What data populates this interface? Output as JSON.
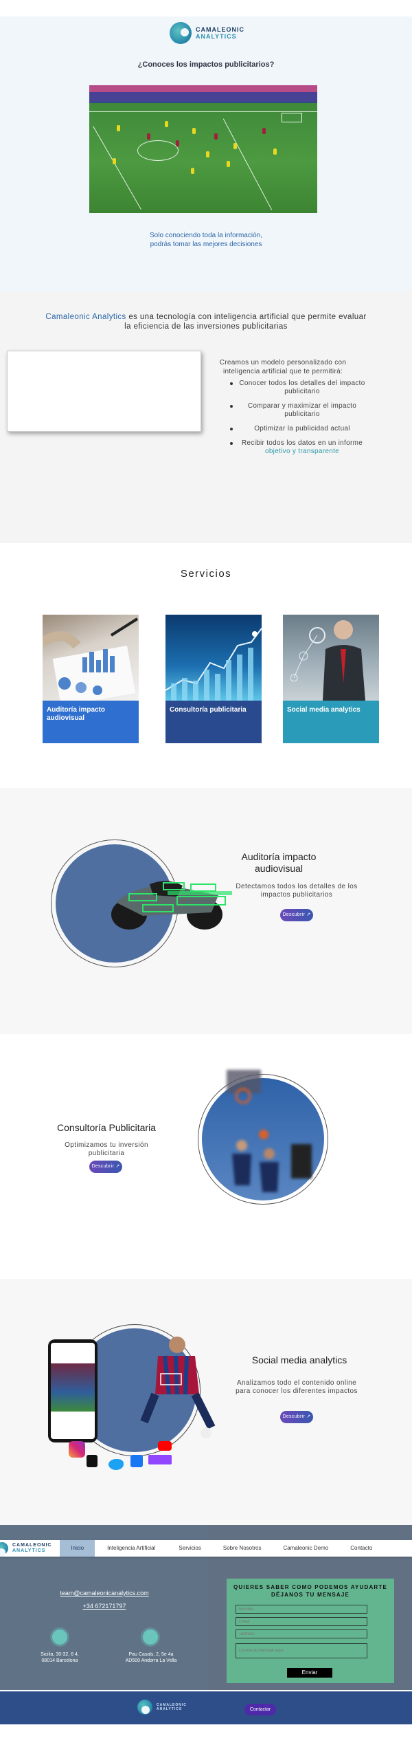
{
  "brand": {
    "line1": "CAMALEONIC",
    "line2": "ANALYTICS"
  },
  "hero": {
    "question": "¿Conoces los impactos publicitarios?",
    "subtitle_line1": "Solo conociendo toda la información,",
    "subtitle_line2": "podrás tomar las mejores decisiones"
  },
  "about": {
    "brand_name": "Camaleonic Analytics",
    "title_rest": " es una tecnología con inteligencia artificial que permite evaluar la eficiencia de las inversiones publicitarias",
    "intro": "Creamos un modelo personalizado con inteligencia artificial que te permitirá:",
    "bullets": [
      "Conocer todos los detalles del impacto publicitario",
      "Comparar y maximizar el impacto publicitario",
      "Optimizar la publicidad actual"
    ],
    "last_bullet_start": "Recibir todos los datos en un informe ",
    "last_bullet_highlight": "objetivo y transparente"
  },
  "servicios": {
    "title": "Servicios",
    "cards": [
      {
        "label": "Auditoría impacto audiovisual",
        "color": "#2f6fcf"
      },
      {
        "label": "Consultoría publicitaria",
        "color": "#294a8e"
      },
      {
        "label": "Social media analytics",
        "color": "#2a9bb8"
      }
    ]
  },
  "auditoria": {
    "title": "Auditoría impacto audiovisual",
    "subtitle": "Detectamos todos los detalles de los impactos publicitarios",
    "button": "Descubrir"
  },
  "consultoria": {
    "title": "Consultoría Publicitaria",
    "subtitle": "Optimizamos tu inversión publicitaria",
    "button": "Descubrir"
  },
  "social": {
    "title": "Social media analytics",
    "subtitle": "Analizamos todo el contenido online para conocer los diferentes impactos",
    "button": "Descubrir"
  },
  "nav": {
    "items": [
      "Inicio",
      "Inteligencia Artificial",
      "Servicios",
      "Sobre Nosotros",
      "Camaleonic Demo",
      "Contacto"
    ]
  },
  "contact": {
    "email": "team@camaleonicanalytics.com",
    "phone": "+34  672171797",
    "addresses": [
      {
        "line1": "Sicilia, 30-32, 6 4,",
        "line2": "08014 Barcelona"
      },
      {
        "line1": "Pau Casals, 2, 5e 4a",
        "line2": "AD500 Andorra La Vella"
      }
    ],
    "form_title_line1": "QUIERES SABER COMO PODEMOS AYUDARTE",
    "form_title_line2": "DÉJANOS TU MENSAJE",
    "fields": [
      "Nombre",
      "Email",
      "Teléfono",
      "Escribe tu mensaje aquí..."
    ],
    "send": "Enviar"
  },
  "footer": {
    "button": "Contactar"
  },
  "colors": {
    "accent_blue": "#2b65a8",
    "teal": "#2e9aa8",
    "form_green": "#63b58f",
    "footer_blue": "#2e4e8a"
  }
}
